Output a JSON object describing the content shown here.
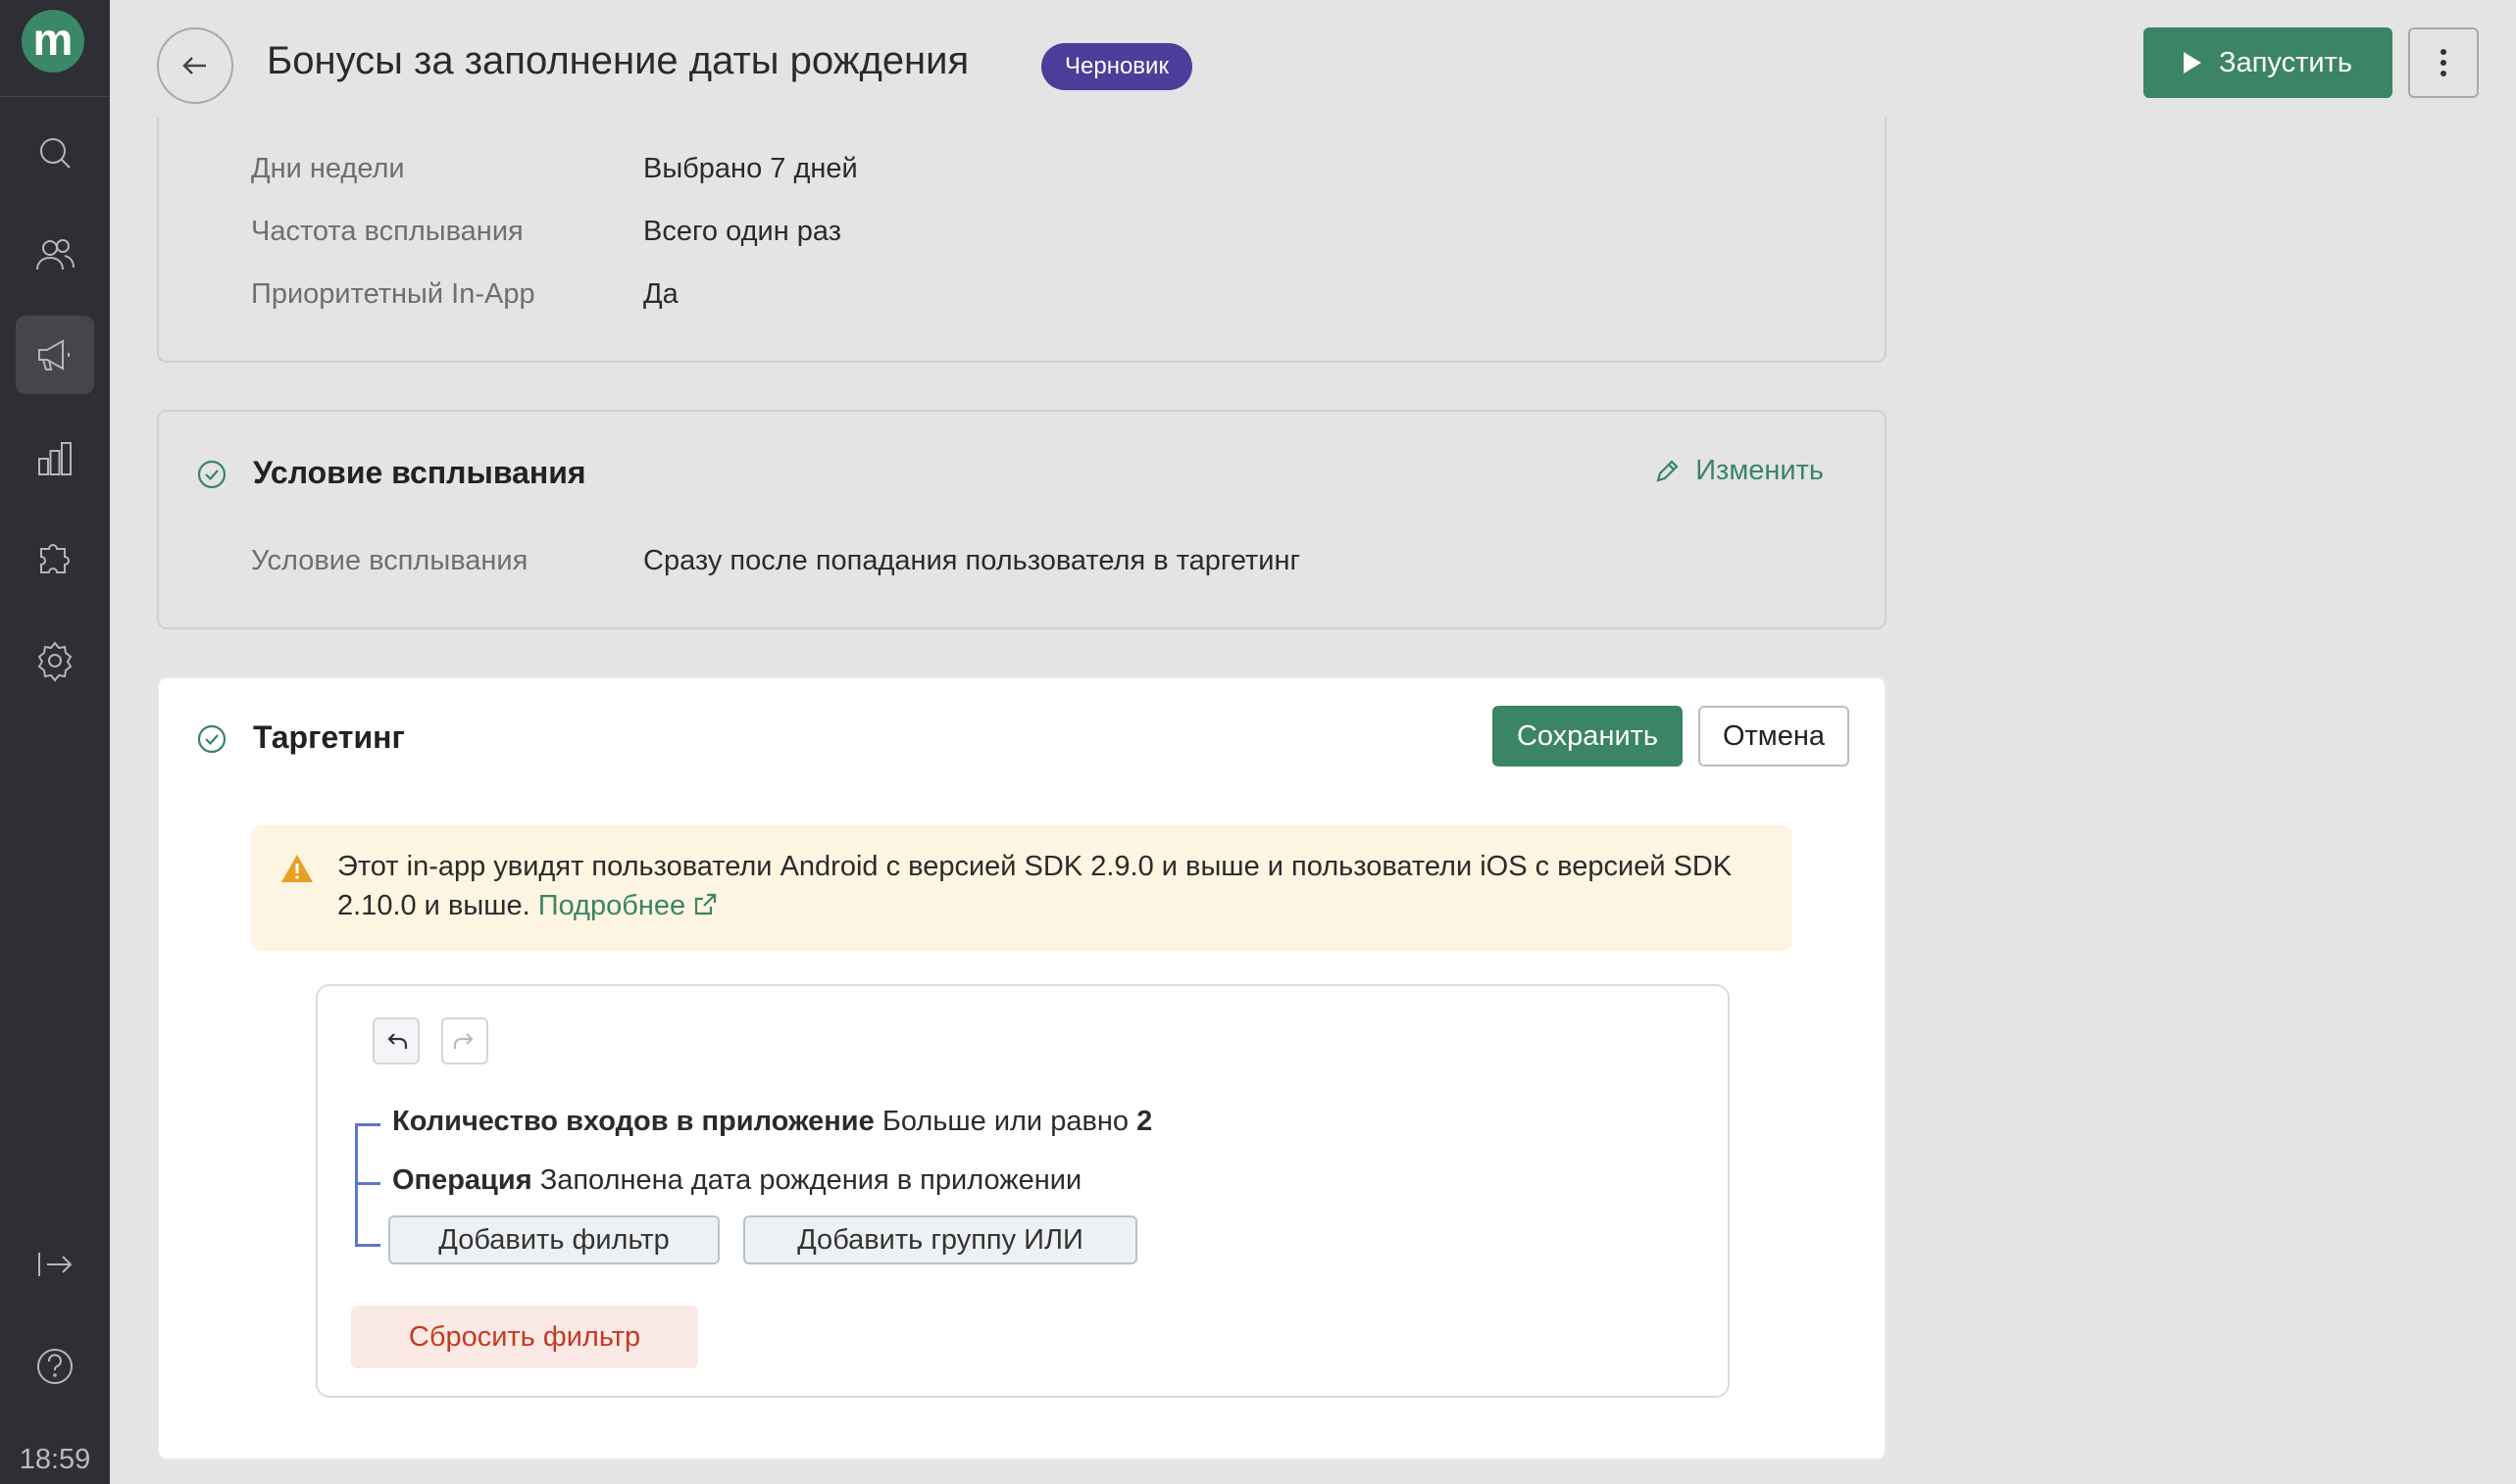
{
  "sidebar": {
    "logo_letter": "m",
    "items": [
      {
        "name": "search-icon",
        "active": false
      },
      {
        "name": "users-icon",
        "active": false
      },
      {
        "name": "megaphone-icon",
        "active": true
      },
      {
        "name": "analytics-icon",
        "active": false
      },
      {
        "name": "puzzle-icon",
        "active": false
      },
      {
        "name": "gear-icon",
        "active": false
      }
    ],
    "logout_icon": "logout-icon",
    "help_icon": "help-icon",
    "time": "18:59"
  },
  "header": {
    "title": "Бонусы за заполнение даты рождения",
    "status_badge": "Черновик",
    "run_label": "Запустить"
  },
  "schedule_card": {
    "rows": [
      {
        "label": "Дни недели",
        "value": "Выбрано 7 дней"
      },
      {
        "label": "Частота всплывания",
        "value": "Всего один раз"
      },
      {
        "label": "Приоритетный In-App",
        "value": "Да"
      }
    ]
  },
  "trigger_card": {
    "title": "Условие всплывания",
    "edit_label": "Изменить",
    "row_label": "Условие всплывания",
    "row_value": "Сразу после попадания пользователя в таргетинг"
  },
  "targeting_card": {
    "title": "Таргетинг",
    "save_label": "Сохранить",
    "cancel_label": "Отмена",
    "warning_text": "Этот in-app увидят пользователи Android с версией SDK 2.9.0 и выше и пользователи iOS с версией SDK 2.10.0 и выше.",
    "warning_link": "Подробнее",
    "conditions": [
      {
        "field": "Количество входов в приложение",
        "operator": "Больше или равно",
        "value": "2"
      },
      {
        "field": "Операция",
        "operator": "Заполнена дата рождения в приложении",
        "value": ""
      }
    ],
    "add_filter_label": "Добавить фильтр",
    "add_or_group_label": "Добавить группу ИЛИ",
    "reset_label": "Сбросить фильтр"
  },
  "colors": {
    "accent": "#3b8466",
    "badge": "#4b3d9a",
    "sidebar": "#2d2f34",
    "warning_bg": "#fdf4e1",
    "reset_text": "#c53a22",
    "tree_line": "#5a78c8"
  }
}
